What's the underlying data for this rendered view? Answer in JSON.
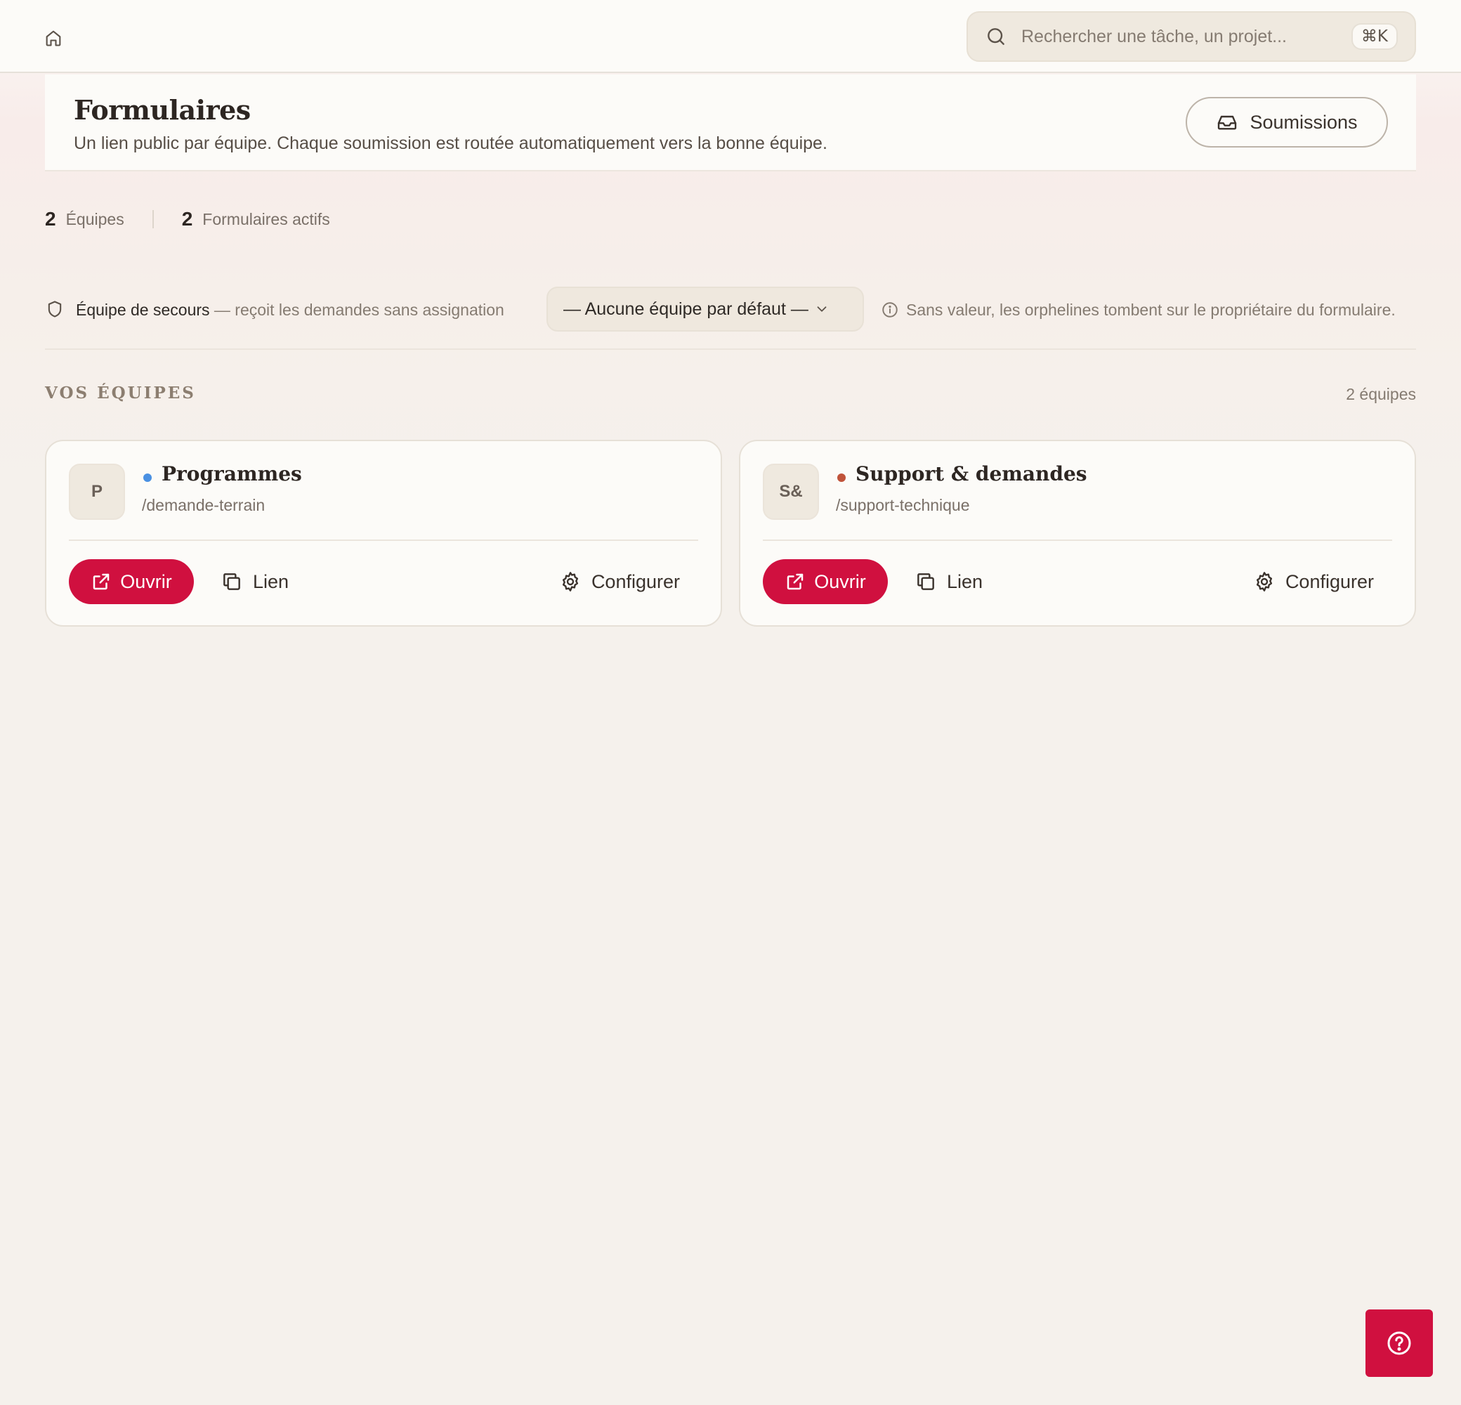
{
  "topbar": {
    "home_icon": "home-icon",
    "search": {
      "placeholder": "Rechercher une tâche, un projet...",
      "shortcut": "⌘K",
      "icon": "search-icon"
    }
  },
  "header": {
    "title": "Formulaires",
    "subtitle": "Un lien public par équipe. Chaque soumission est routée automatiquement vers la bonne équipe.",
    "submissions_button": {
      "label": "Soumissions",
      "icon": "inbox-icon"
    }
  },
  "stats": [
    {
      "value": "2",
      "label": "Équipes"
    },
    {
      "value": "2",
      "label": "Formulaires actifs"
    }
  ],
  "fallback": {
    "icon": "shield-icon",
    "label": "Équipe de secours",
    "description": " — reçoit les demandes sans assignation",
    "select_value": "— Aucune équipe par défaut —",
    "note_icon": "info-icon",
    "note": "Sans valeur, les orphelines tombent sur le propriétaire du formulaire."
  },
  "teams_section": {
    "title": "VOS ÉQUIPES",
    "count": "2 équipes",
    "teams": [
      {
        "initials": "P",
        "name": "Programmes",
        "slug": "/demande-terrain",
        "dot_color": "#4a90e2",
        "open_label": "Ouvrir",
        "link_label": "Lien",
        "configure_label": "Configurer"
      },
      {
        "initials": "S&",
        "name": "Support & demandes",
        "slug": "/support-technique",
        "dot_color": "#c0533a",
        "open_label": "Ouvrir",
        "link_label": "Lien",
        "configure_label": "Configurer"
      }
    ]
  },
  "colors": {
    "accent": "#d0103f",
    "background": "#f5f1ec",
    "card": "#fcfbf8"
  },
  "help_button": {
    "icon": "help-circle-icon"
  }
}
